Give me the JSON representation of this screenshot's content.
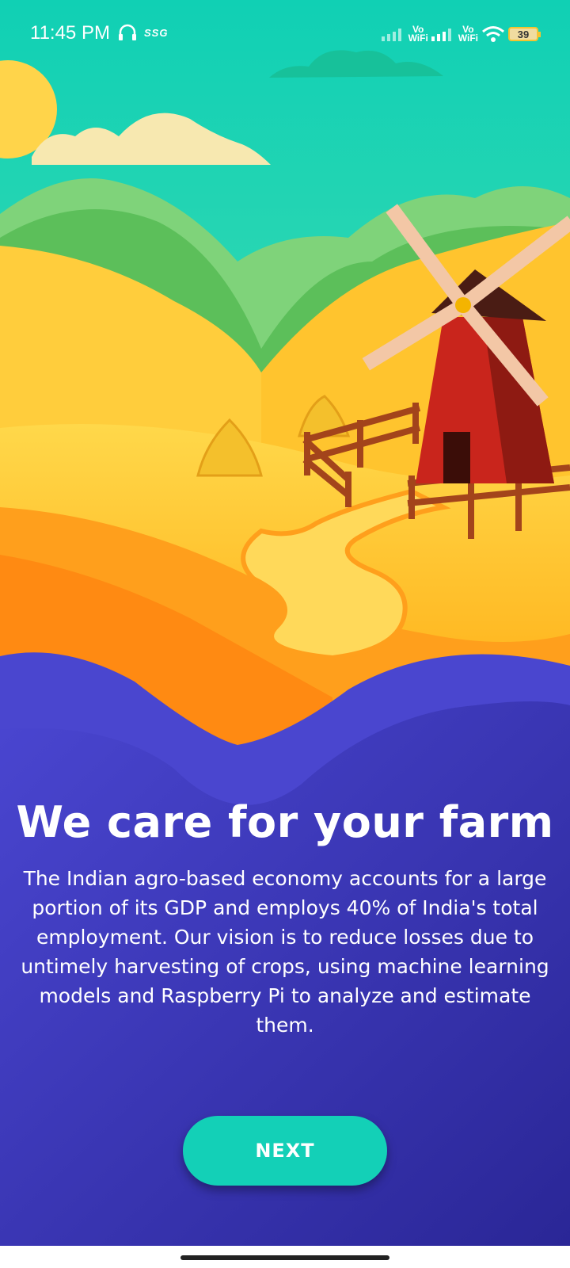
{
  "status_bar": {
    "time": "11:45 PM",
    "carrier_badge": "SSG",
    "vowifi_1": [
      "Vo",
      "WiFi"
    ],
    "vowifi_2": [
      "Vo",
      "WiFi"
    ],
    "battery_level": "39",
    "icons": [
      "headset-icon",
      "signal-icon",
      "wifi-icon",
      "battery-icon"
    ]
  },
  "onboarding": {
    "title": "We care for your farm",
    "description": "The Indian agro-based economy accounts for a large portion of its GDP and employs 40% of India's total employment. Our vision is to reduce losses due to untimely harvesting of crops, using machine learning models and Raspberry Pi to analyze and estimate them.",
    "next_label": "NEXT"
  },
  "colors": {
    "panel": "#3a33b8",
    "button": "#13d0b7",
    "sky": "#2fd6b4"
  }
}
